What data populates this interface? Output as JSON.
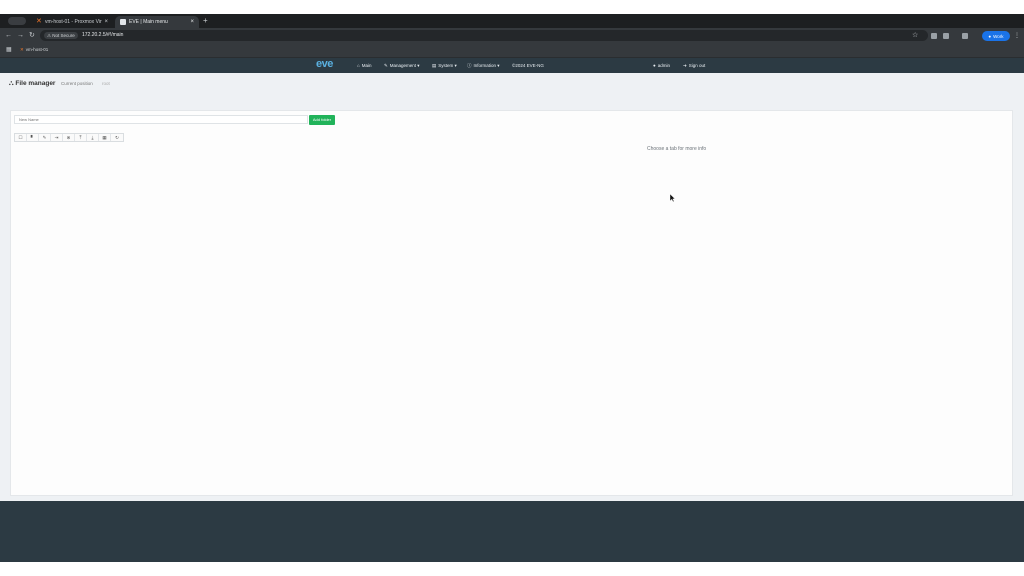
{
  "browser": {
    "tabs": [
      {
        "title": "vm-host-01 - Proxmox Virtua",
        "favicon": "proxmox-icon",
        "active": false
      },
      {
        "title": "EVE | Main menu",
        "favicon": "eve-icon",
        "active": true
      }
    ],
    "new_tab": "+",
    "security_label": "Not Secure",
    "url": "172.20.2.5/#!/main",
    "profile_label": "Work",
    "bookmarks": [
      {
        "label": "vm-host-01",
        "icon": "proxmox-icon"
      }
    ]
  },
  "eve": {
    "logo": "eve",
    "nav": {
      "main": "Main",
      "management": "Management ▾",
      "system": "System ▾",
      "information": "Information ▾",
      "copyright": "©2024 EVE-NG",
      "user": "admin",
      "signout": "Sign out"
    },
    "page": {
      "title": "File manager",
      "breadcrumb_label": "Current position",
      "breadcrumb_root": "root",
      "new_name_placeholder": "New Name",
      "add_folder": "Add folder",
      "info": "Choose a tab for more info"
    },
    "toolbar_icons": [
      "select-all-icon",
      "new-file-icon",
      "edit-icon",
      "move-icon",
      "delete-icon",
      "export-icon",
      "import-icon",
      "grid-icon",
      "refresh-icon"
    ]
  },
  "colors": {
    "navbar": "#2c3a43",
    "add_folder_button": "#21b35a",
    "chrome_tabbar": "#1d1f21",
    "profile_button": "#1a73e8"
  }
}
